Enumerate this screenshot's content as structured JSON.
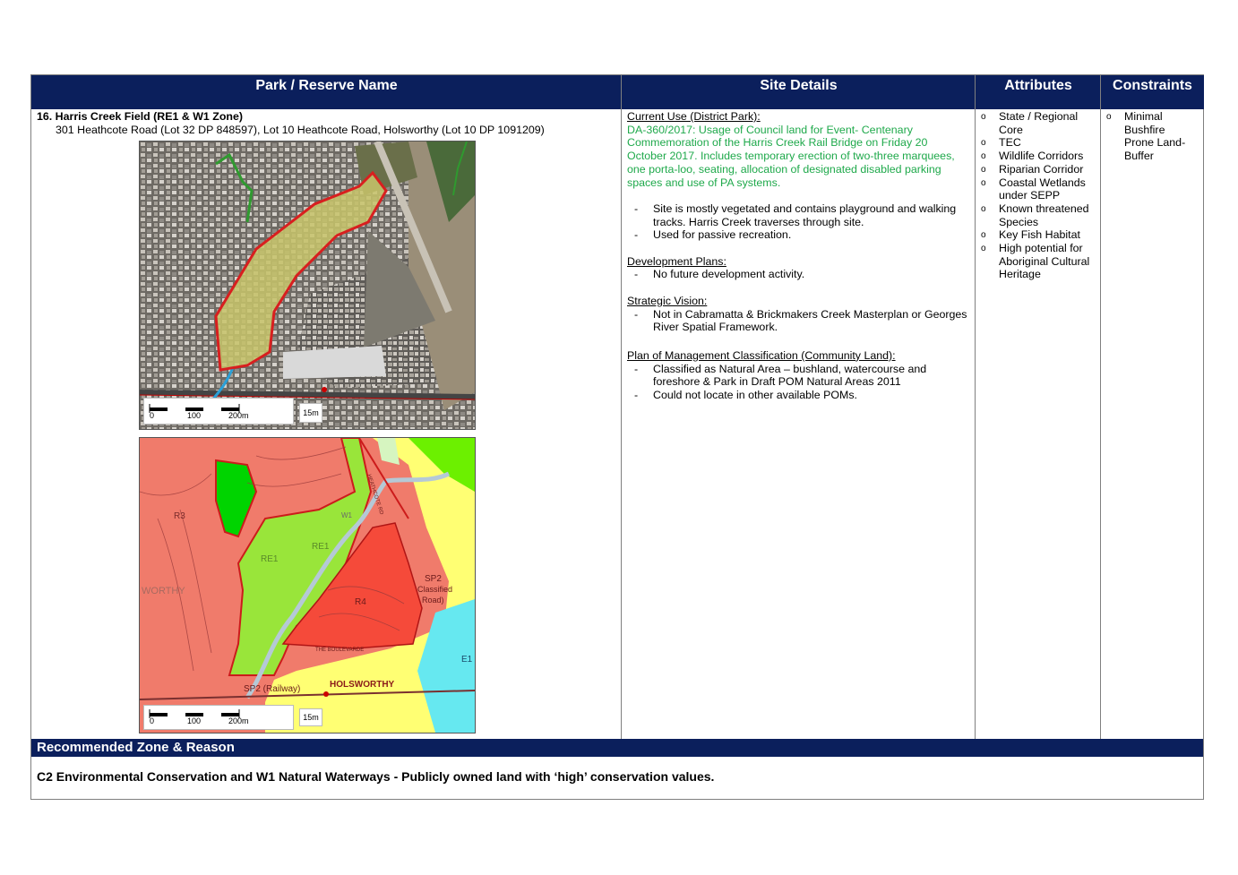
{
  "headers": {
    "park": "Park / Reserve Name",
    "site": "Site Details",
    "attributes": "Attributes",
    "constraints": "Constraints"
  },
  "park": {
    "title": "16. Harris Creek Field (RE1 & W1 Zone)",
    "address": "301 Heathcote Road (Lot 32 DP 848597), Lot 10 Heathcote Road, Holsworthy (Lot 10 DP 1091209)"
  },
  "map1": {
    "scale_labels": [
      "0",
      "100",
      "200m"
    ],
    "legend_badge": "15m",
    "road_label": "HEATHCOTE RD"
  },
  "map2": {
    "scale_labels": [
      "0",
      "100",
      "200m"
    ],
    "legend_badge": "15m",
    "labels": {
      "r3": "R3",
      "re1a": "RE1",
      "re1b": "RE1",
      "r4": "R4",
      "sp2_road": "SP2",
      "classified": "Classified",
      "road": "Road)",
      "e1": "E1",
      "sp2_rail": "SP2 (Railway)",
      "holsworthy": "HOLSWORTHY",
      "worthy": "WORTHY",
      "boulevarde": "THE BOULEVARDE",
      "heathcote": "HEATHCOTE RD",
      "w1": "W1"
    }
  },
  "site": {
    "current_use_heading": "Current Use (District Park):",
    "da_note": "DA-360/2017:  Usage of Council land for Event- Centenary Commemoration of the Harris Creek Rail Bridge on Friday 20 October 2017. Includes temporary erection of two-three marquees, one porta-loo, seating, allocation of designated disabled parking spaces and use of PA systems.",
    "current_use_items": [
      "Site is mostly vegetated and contains playground and walking tracks. Harris Creek traverses through site.",
      "Used for passive recreation."
    ],
    "development_heading": "Development Plans:",
    "development_items": [
      "No future development activity."
    ],
    "vision_heading": "Strategic Vision:",
    "vision_items": [
      "Not in Cabramatta & Brickmakers Creek Masterplan or Georges River Spatial Framework."
    ],
    "pom_heading": "Plan of Management Classification (Community Land):",
    "pom_items": [
      "Classified as Natural Area – bushland, watercourse and foreshore & Park in Draft POM Natural Areas 2011",
      "Could not locate in other available POMs."
    ]
  },
  "attributes": [
    "State / Regional Core",
    "TEC",
    "Wildlife Corridors",
    "Riparian Corridor",
    "Coastal Wetlands under SEPP",
    "Known threatened Species",
    "Key Fish Habitat",
    "High potential for Aboriginal Cultural Heritage"
  ],
  "constraints": [
    "Minimal Bushfire Prone Land-Buffer"
  ],
  "recommended": {
    "heading": "Recommended Zone & Reason",
    "text": "C2 Environmental Conservation and W1 Natural Waterways - Publicly owned land with ‘high’ conservation values."
  }
}
